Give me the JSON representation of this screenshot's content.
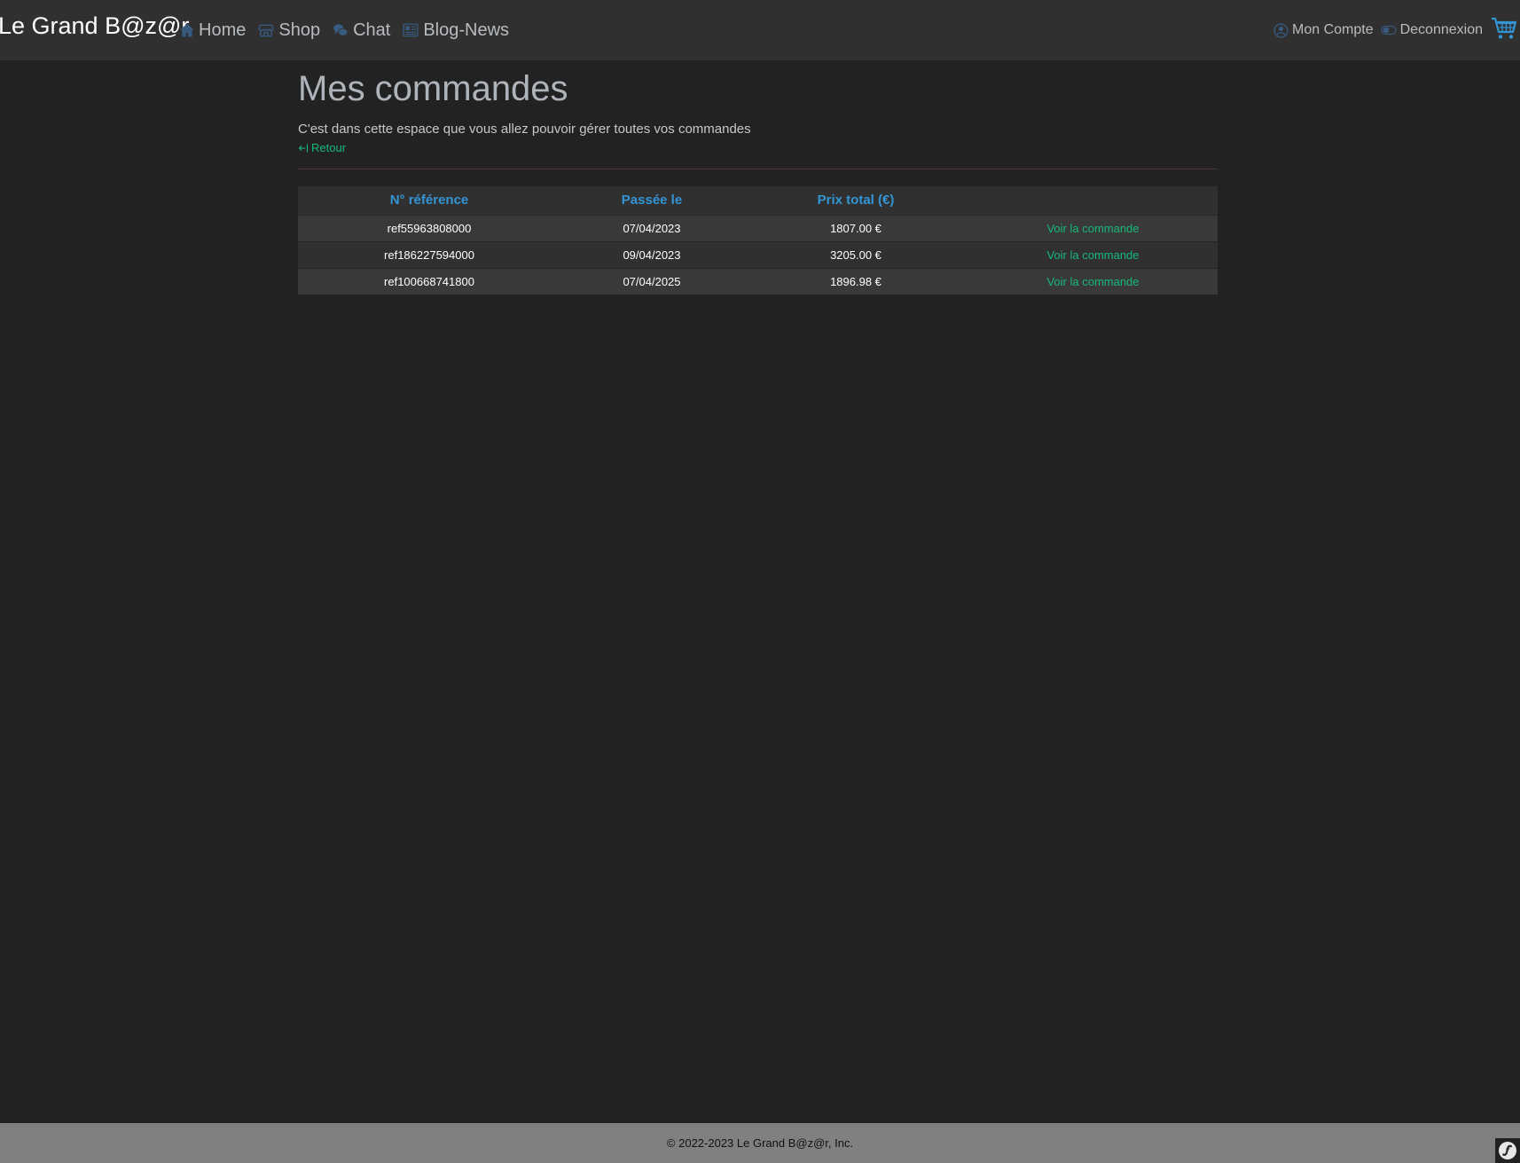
{
  "navbar": {
    "brand": "Le Grand B@z@r",
    "items": [
      {
        "label": "Home",
        "icon": "house-icon"
      },
      {
        "label": "Shop",
        "icon": "shop-icon"
      },
      {
        "label": "Chat",
        "icon": "chat-icon"
      },
      {
        "label": "Blog-News",
        "icon": "newspaper-icon"
      }
    ],
    "account": {
      "label": "Mon Compte",
      "icon": "person-circle-icon"
    },
    "logout": {
      "label": "Deconnexion",
      "icon": "toggle-icon"
    },
    "cart_icon": "cart-icon",
    "icon_color": "#375a7f",
    "cart_color": "#3395d4"
  },
  "main": {
    "title": "Mes commandes",
    "subtitle": "C'est dans cette espace que vous allez pouvoir gérer toutes vos commandes",
    "back_label": "Retour",
    "back_icon": "arrow-bar-left-icon",
    "link_color": "#17b87a"
  },
  "table": {
    "columns": [
      "N° référence",
      "Passée le",
      "Prix total (€)",
      ""
    ],
    "header_color": "#3395d4",
    "rows": [
      {
        "reference": "ref55963808000",
        "date": "07/04/2023",
        "total": "1807.00 €",
        "action": "Voir la commande"
      },
      {
        "reference": "ref186227594000",
        "date": "09/04/2023",
        "total": "3205.00 €",
        "action": "Voir la commande"
      },
      {
        "reference": "ref100668741800",
        "date": "07/04/2025",
        "total": "1896.98 €",
        "action": "Voir la commande"
      }
    ]
  },
  "footer": {
    "text": "© 2022-2023 Le Grand B@z@r, Inc.",
    "badge_icon": "symfony-icon"
  }
}
